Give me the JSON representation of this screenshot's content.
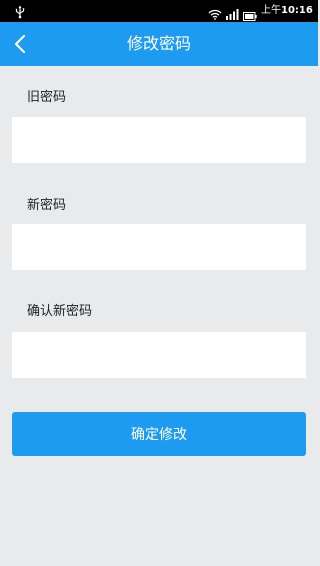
{
  "status_bar": {
    "time_prefix": "上午",
    "time": "10:16",
    "icons": [
      "usb-icon",
      "wifi-icon",
      "signal-icon",
      "battery-icon"
    ]
  },
  "header": {
    "title": "修改密码",
    "back_icon": "chevron-left-icon"
  },
  "form": {
    "old_password_label": "旧密码",
    "old_password_value": "",
    "new_password_label": "新密码",
    "new_password_value": "",
    "confirm_password_label": "确认新密码",
    "confirm_password_value": ""
  },
  "submit_label": "确定修改",
  "colors": {
    "accent": "#1d9bf0",
    "background": "#e8eaec",
    "status_bar": "#000000",
    "field_background": "#ffffff",
    "label_text": "#222222"
  }
}
